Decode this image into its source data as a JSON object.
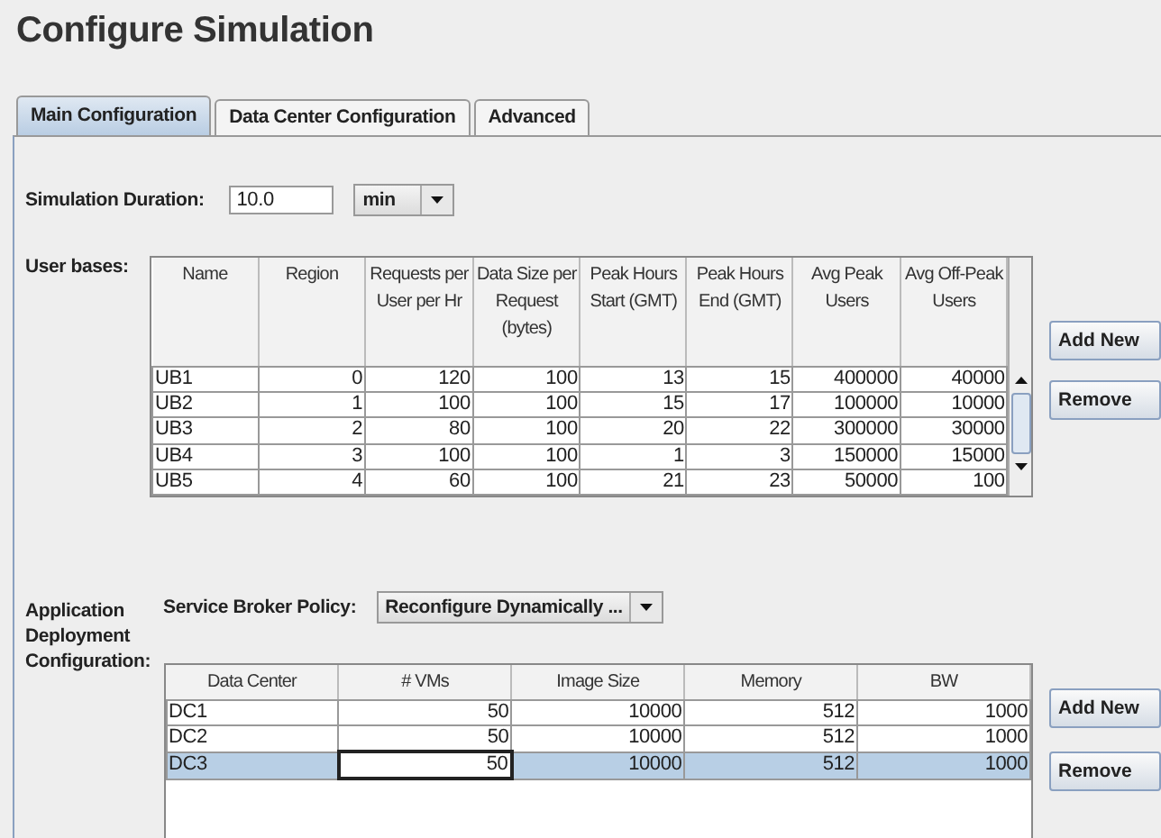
{
  "title": "Configure Simulation",
  "tabs": [
    {
      "label": "Main Configuration",
      "selected": true
    },
    {
      "label": "Data Center Configuration",
      "selected": false
    },
    {
      "label": "Advanced",
      "selected": false
    }
  ],
  "simulation_duration": {
    "label": "Simulation Duration:",
    "value": "10.0",
    "unit": "min"
  },
  "user_bases": {
    "label": "User bases:",
    "columns": [
      "Name",
      "Region",
      "Requests per User per Hr",
      "Data Size per Request (bytes)",
      "Peak Hours Start (GMT)",
      "Peak Hours End (GMT)",
      "Avg Peak Users",
      "Avg Off-Peak Users"
    ],
    "rows": [
      [
        "UB1",
        "0",
        "120",
        "100",
        "13",
        "15",
        "400000",
        "40000"
      ],
      [
        "UB2",
        "1",
        "100",
        "100",
        "15",
        "17",
        "100000",
        "10000"
      ],
      [
        "UB3",
        "2",
        "80",
        "100",
        "20",
        "22",
        "300000",
        "30000"
      ],
      [
        "UB4",
        "3",
        "100",
        "100",
        "1",
        "3",
        "150000",
        "15000"
      ],
      [
        "UB5",
        "4",
        "60",
        "100",
        "21",
        "23",
        "50000",
        "100"
      ]
    ],
    "buttons": [
      "Add New",
      "Remove"
    ]
  },
  "deployment": {
    "label": [
      "Application",
      "Deployment",
      "Configuration:"
    ],
    "policy_label": "Service Broker Policy:",
    "policy_value": "Reconfigure Dynamically ...",
    "columns": [
      "Data Center",
      "# VMs",
      "Image Size",
      "Memory",
      "BW"
    ],
    "rows": [
      {
        "cells": [
          {
            "text": "DC1",
            "editing": false
          },
          {
            "text": "50",
            "editing": false
          },
          {
            "text": "10000",
            "editing": false
          },
          {
            "text": "512",
            "editing": false
          },
          {
            "text": "1000",
            "editing": false
          }
        ],
        "selected": false
      },
      {
        "cells": [
          {
            "text": "DC2",
            "editing": false
          },
          {
            "text": "50",
            "editing": false
          },
          {
            "text": "10000",
            "editing": false
          },
          {
            "text": "512",
            "editing": false
          },
          {
            "text": "1000",
            "editing": false
          }
        ],
        "selected": false
      },
      {
        "cells": [
          {
            "text": "DC3",
            "editing": false
          },
          {
            "text": "50",
            "editing": true
          },
          {
            "text": "10000",
            "editing": false
          },
          {
            "text": "512",
            "editing": false
          },
          {
            "text": "1000",
            "editing": false
          }
        ],
        "selected": true
      }
    ],
    "buttons": [
      "Add New",
      "Remove"
    ]
  }
}
